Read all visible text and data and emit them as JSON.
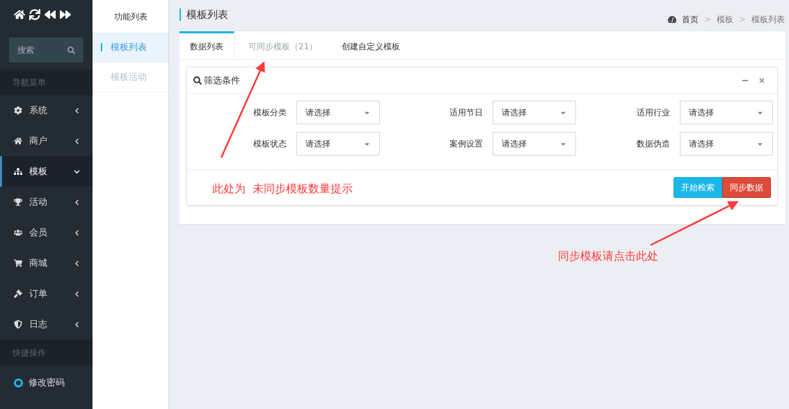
{
  "sidebar": {
    "search": {
      "placeholder": "搜索"
    },
    "sections": [
      {
        "title": "导航菜单",
        "items": [
          {
            "label": "系统",
            "expanded": false,
            "selected": false
          },
          {
            "label": "商户",
            "expanded": false,
            "selected": false
          },
          {
            "label": "模板",
            "expanded": true,
            "selected": true
          },
          {
            "label": "活动",
            "expanded": false,
            "selected": false
          },
          {
            "label": "会员",
            "expanded": false,
            "selected": false
          },
          {
            "label": "商城",
            "expanded": false,
            "selected": false
          },
          {
            "label": "订单",
            "expanded": false,
            "selected": false
          },
          {
            "label": "日志",
            "expanded": false,
            "selected": false
          }
        ]
      },
      {
        "title": "快捷操作",
        "items": [
          {
            "label": "修改密码",
            "color": "#1ab7ea"
          }
        ]
      }
    ]
  },
  "subnav": {
    "title": "功能列表",
    "items": [
      {
        "label": "模板列表",
        "selected": true
      },
      {
        "label": "模板活动",
        "selected": false
      }
    ]
  },
  "page": {
    "title": "模板列表",
    "breadcrumb": [
      "首页",
      "模板",
      "模板列表"
    ],
    "breadcrumb_separator": ">"
  },
  "tabs": [
    {
      "label": "数据列表",
      "selected": true,
      "disabled": false
    },
    {
      "label": "可同步模板（21）",
      "selected": false,
      "disabled": true
    },
    {
      "label": "创建自定义模板",
      "selected": false,
      "disabled": false
    }
  ],
  "filter_panel": {
    "title": "筛选条件",
    "fields": [
      {
        "label": "模板分类",
        "value": "请选择"
      },
      {
        "label": "适用节日",
        "value": "请选择"
      },
      {
        "label": "适用行业",
        "value": "请选择"
      },
      {
        "label": "模板状态",
        "value": "请选择"
      },
      {
        "label": "案例设置",
        "value": "请选择"
      },
      {
        "label": "数据伪造",
        "value": "请选择"
      }
    ],
    "buttons": [
      {
        "label": "开始检索",
        "kind": "primary"
      },
      {
        "label": "同步数据",
        "kind": "danger"
      }
    ]
  },
  "annotations": [
    "此处为  未同步模板数量提示",
    "同步模板请点击此处"
  ]
}
